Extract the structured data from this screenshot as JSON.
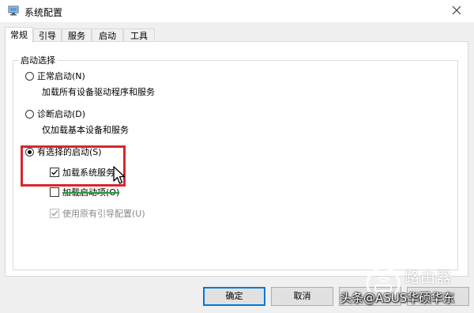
{
  "window": {
    "title": "系统配置",
    "close_icon": "close-icon"
  },
  "tabs": [
    {
      "label": "常规",
      "active": true
    },
    {
      "label": "引导",
      "active": false
    },
    {
      "label": "服务",
      "active": false
    },
    {
      "label": "启动",
      "active": false
    },
    {
      "label": "工具",
      "active": false
    }
  ],
  "startup_selection": {
    "group_label": "启动选择",
    "normal": {
      "label": "正常启动(N)",
      "description": "加载所有设备驱动程序和服务",
      "checked": false
    },
    "diagnostic": {
      "label": "诊断启动(D)",
      "description": "仅加载基本设备和服务",
      "checked": false
    },
    "selective": {
      "label": "有选择的启动(S)",
      "checked": true,
      "options": [
        {
          "label": "加载系统服务",
          "checked": true,
          "enabled": true
        },
        {
          "label": "加载启动项(O)",
          "checked": false,
          "enabled": true
        },
        {
          "label": "使用原有引导配置(U)",
          "checked": true,
          "enabled": false
        }
      ]
    }
  },
  "buttons": {
    "ok": "确定",
    "cancel": "取消"
  },
  "watermark": {
    "text": "头条@ASUS华硕华东",
    "logo_text": "路由器"
  },
  "colors": {
    "highlight": "#d9262b",
    "strike": "#2e9a3c",
    "default_button_border": "#0078d7"
  }
}
